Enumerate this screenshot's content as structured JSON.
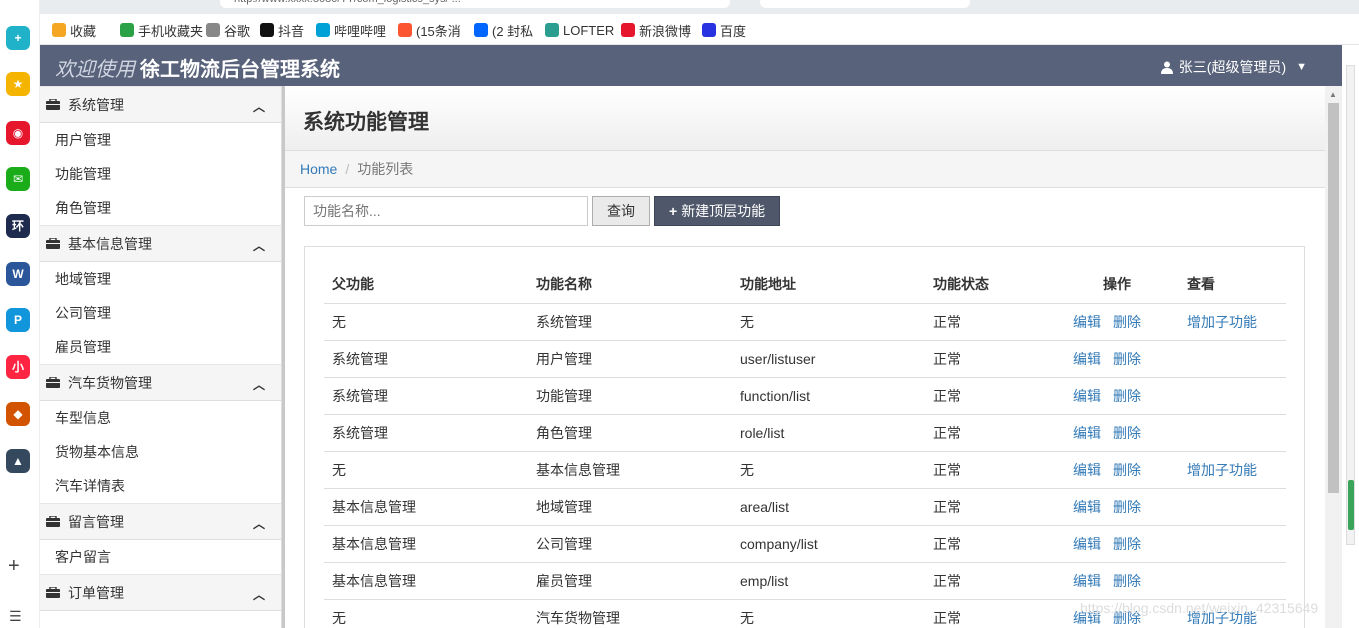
{
  "browser": {
    "url_fragment": "http://www.xxxx:8080/TT/com_logistics_sys/ ...",
    "bookmarks": [
      {
        "label": "收藏",
        "icon": "star-icon",
        "color": "#f5a623"
      },
      {
        "label": "手机收藏夹",
        "icon": "phone-icon",
        "color": "#2ba245"
      },
      {
        "label": "谷歌",
        "icon": "page-icon",
        "color": "#888888"
      },
      {
        "label": "抖音",
        "icon": "douyin-icon",
        "color": "#111111"
      },
      {
        "label": "哔哩哔哩",
        "icon": "bilibili-icon",
        "color": "#00a1d6"
      },
      {
        "label": "(15条消",
        "icon": "c-icon",
        "color": "#fc5531"
      },
      {
        "label": "(2 封私",
        "icon": "zhihu-icon",
        "color": "#0066ff"
      },
      {
        "label": "LOFTER",
        "icon": "lofter-icon",
        "color": "#2b9e8f"
      },
      {
        "label": "新浪微博",
        "icon": "weibo-icon",
        "color": "#e6162d"
      },
      {
        "label": "百度",
        "icon": "baidu-icon",
        "color": "#2932e1"
      }
    ],
    "side_apps": [
      {
        "name": "app-plus-icon",
        "glyph": "+",
        "color": "#20b2c8"
      },
      {
        "name": "app-star-icon",
        "glyph": "★",
        "color": "#f5b400"
      },
      {
        "name": "app-weibo-icon",
        "glyph": "◉",
        "color": "#e6162d"
      },
      {
        "name": "app-mail-icon",
        "glyph": "✉",
        "color": "#1aad19"
      },
      {
        "name": "app-news-icon",
        "glyph": "环",
        "color": "#1e2b4f"
      },
      {
        "name": "app-doc-icon",
        "glyph": "W",
        "color": "#2b579a"
      },
      {
        "name": "app-p-icon",
        "glyph": "P",
        "color": "#1296db"
      },
      {
        "name": "app-xhs-icon",
        "glyph": "小",
        "color": "#ff2442"
      },
      {
        "name": "app-game1-icon",
        "glyph": "◆",
        "color": "#d35400"
      },
      {
        "name": "app-game2-icon",
        "glyph": "▲",
        "color": "#34495e"
      }
    ]
  },
  "header": {
    "welcome": "欢迎使用",
    "title": "徐工物流后台管理系统",
    "user": "张三(超级管理员)"
  },
  "sidebar": {
    "groups": [
      {
        "title": "系统管理",
        "items": [
          "用户管理",
          "功能管理",
          "角色管理"
        ]
      },
      {
        "title": "基本信息管理",
        "items": [
          "地域管理",
          "公司管理",
          "雇员管理"
        ]
      },
      {
        "title": "汽车货物管理",
        "items": [
          "车型信息",
          "货物基本信息",
          "汽车详情表"
        ]
      },
      {
        "title": "留言管理",
        "items": [
          "客户留言"
        ]
      },
      {
        "title": "订单管理",
        "items": []
      }
    ]
  },
  "page": {
    "title": "系统功能管理",
    "breadcrumb": {
      "home": "Home",
      "current": "功能列表"
    }
  },
  "toolbar": {
    "search_placeholder": "功能名称...",
    "query_label": "查询",
    "new_label": "新建顶层功能"
  },
  "table": {
    "headers": [
      "父功能",
      "功能名称",
      "功能地址",
      "功能状态",
      "操作",
      "查看"
    ],
    "edit_label": "编辑",
    "delete_label": "删除",
    "add_child_label": "增加子功能",
    "rows": [
      {
        "parent": "无",
        "name": "系统管理",
        "url": "无",
        "status": "正常",
        "add_child": true
      },
      {
        "parent": "系统管理",
        "name": "用户管理",
        "url": "user/listuser",
        "status": "正常",
        "add_child": false
      },
      {
        "parent": "系统管理",
        "name": "功能管理",
        "url": "function/list",
        "status": "正常",
        "add_child": false
      },
      {
        "parent": "系统管理",
        "name": "角色管理",
        "url": "role/list",
        "status": "正常",
        "add_child": false
      },
      {
        "parent": "无",
        "name": "基本信息管理",
        "url": "无",
        "status": "正常",
        "add_child": true
      },
      {
        "parent": "基本信息管理",
        "name": "地域管理",
        "url": "area/list",
        "status": "正常",
        "add_child": false
      },
      {
        "parent": "基本信息管理",
        "name": "公司管理",
        "url": "company/list",
        "status": "正常",
        "add_child": false
      },
      {
        "parent": "基本信息管理",
        "name": "雇员管理",
        "url": "emp/list",
        "status": "正常",
        "add_child": false
      },
      {
        "parent": "无",
        "name": "汽车货物管理",
        "url": "无",
        "status": "正常",
        "add_child": true
      }
    ]
  },
  "watermark": "https://blog.csdn.net/weixin_42315649"
}
